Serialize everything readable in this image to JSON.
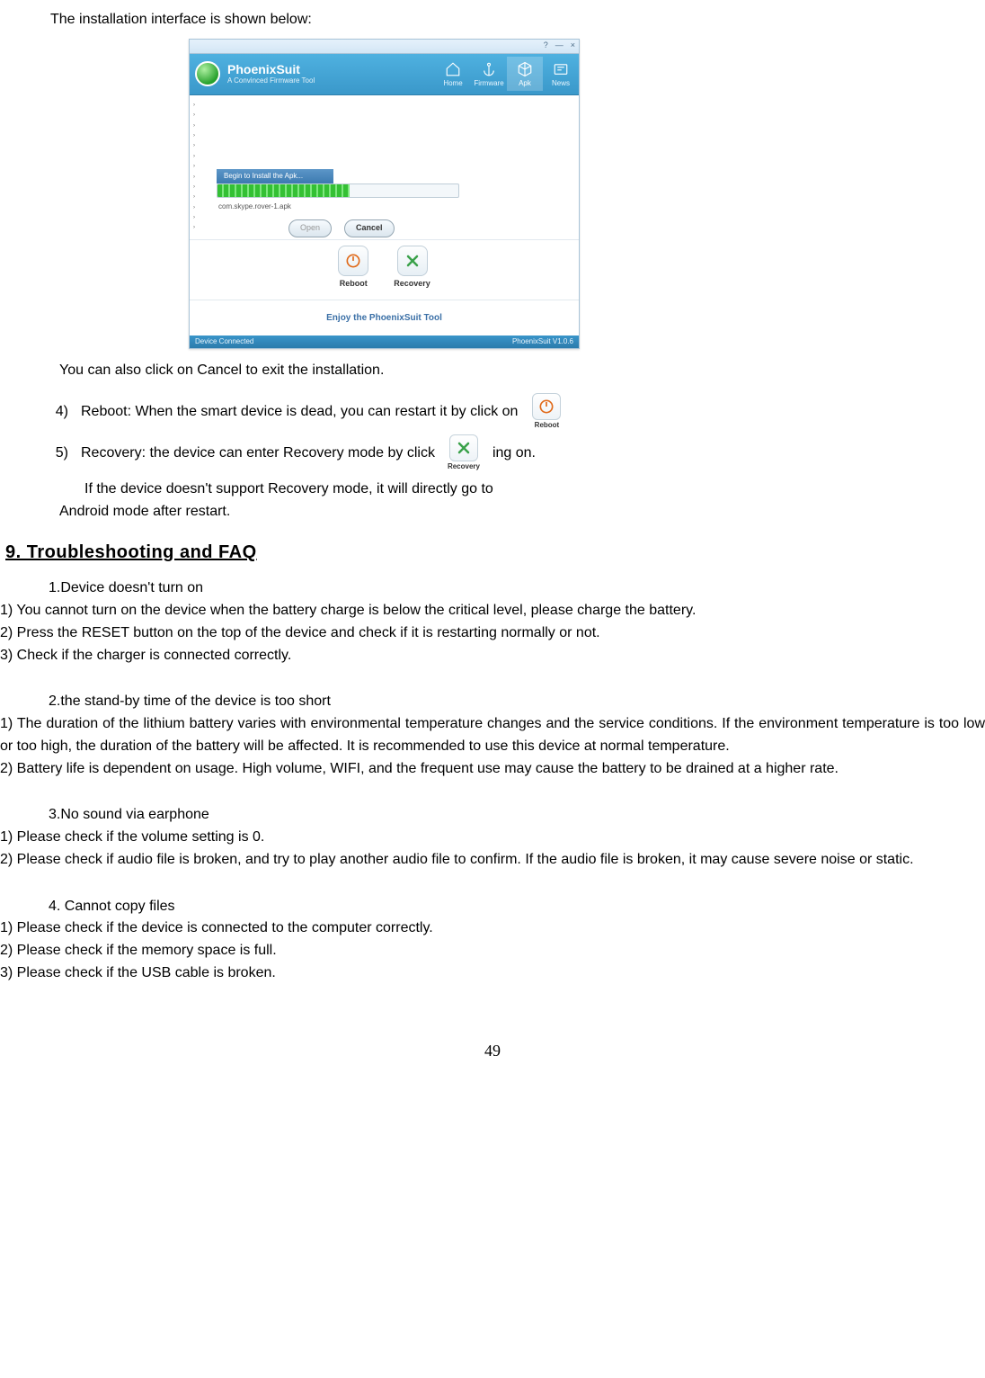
{
  "intro": "The installation interface is shown below:",
  "ps": {
    "titlebar": {
      "help": "?",
      "min": "—",
      "close": "×"
    },
    "brand": {
      "name": "PhoenixSuit",
      "sub": "A Convinced Firmware Tool"
    },
    "nav": {
      "home": "Home",
      "firmware": "Firmware",
      "apk": "Apk",
      "news": "News"
    },
    "begin": "Begin to Install the Apk...",
    "apk": "com.skype.rover-1.apk",
    "btn_open": "Open",
    "btn_cancel": "Cancel",
    "btn_reboot": "Reboot",
    "btn_recovery": "Recovery",
    "banner": "Enjoy the PhoenixSuit Tool",
    "status_left": "Device Connected",
    "status_right": "PhoenixSuit V1.0.6"
  },
  "after_img": "You can also click on Cancel to exit the installation.",
  "item4": {
    "num": "4)",
    "text": "Reboot: When the smart device is dead, you can restart it by click on"
  },
  "item5": {
    "num": "5)",
    "pre": "Recovery: the device can enter Recovery mode by click",
    "post": "ing on."
  },
  "note_line1": "If  the  device  doesn't  support  Recovery  mode,  it  will  directly  go  to",
  "note_line2": "Android mode after restart.",
  "section9": "9. Troubleshooting and FAQ",
  "faq1": {
    "head": "1.Device doesn't turn on",
    "a": "1) You cannot turn on the device when the battery charge is below the critical level, please charge the battery.",
    "b": "2) Press the RESET button on the top of the device and check if it is restarting normally or not.",
    "c": "3) Check if the charger is connected correctly."
  },
  "faq2": {
    "head": "2.the stand-by time of the device is too short",
    "a": "1) The duration of the lithium battery varies with environmental temperature changes and the service conditions. If the environment temperature is too low or too high, the duration of the battery will be affected. It is recommended to use this device at normal temperature.",
    "b": "2) Battery life is dependent on usage. High volume, WIFI, and the frequent use may cause the battery to be drained at a higher rate."
  },
  "faq3": {
    "head": "3.No sound via earphone",
    "a": "1) Please check if the volume setting is 0.",
    "b": "2) Please check if audio file is broken, and try to play another audio file to confirm. If the audio file is broken, it may cause severe noise or static."
  },
  "faq4": {
    "head": "4. Cannot copy files",
    "a": "1) Please check if the device is connected to the computer correctly.",
    "b": "2) Please check if the memory space is full.",
    "c": "3) Please check if the USB cable is broken."
  },
  "page": "49"
}
